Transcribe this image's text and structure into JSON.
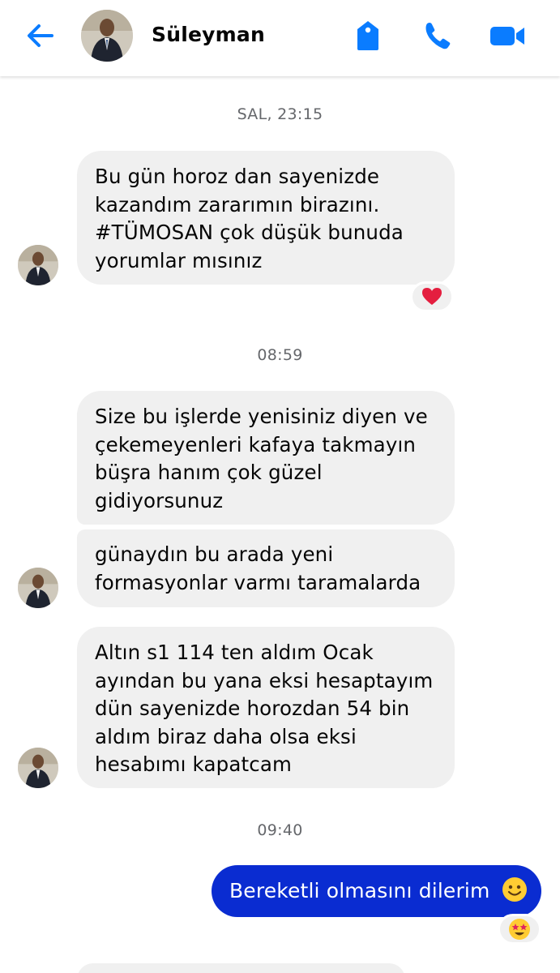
{
  "header": {
    "contact_name": "Süleyman",
    "icons": [
      "back-arrow-icon",
      "tag-icon",
      "phone-icon",
      "video-camera-icon"
    ],
    "accent_color": "#0a7cff"
  },
  "messages": {
    "ts1": "SAL, 23:15",
    "m1": {
      "lines": [
        "Bu gün horoz dan sayenizde",
        "kazandım zararımın birazını.",
        "#TÜMOSAN çok düşük bunuda",
        "yorumlar mısınız"
      ],
      "reaction": "heart"
    },
    "ts2": "08:59",
    "m2": {
      "lines": [
        "Size bu işlerde yenisiniz diyen ve",
        "çekemeyenleri kafaya takmayın",
        "büşra hanım çok güzel",
        "gidiyorsunuz"
      ]
    },
    "m3": {
      "lines": [
        "günaydın bu arada yeni",
        "formasyonlar varmı taramalarda"
      ]
    },
    "m4": {
      "lines": [
        "Altın s1 114 ten aldım Ocak",
        "ayından bu yana eksi hesaptayım",
        "dün sayenizde horozdan 54 bin",
        "aldım biraz daha olsa eksi",
        "hesabımı kapatcam"
      ]
    },
    "ts3": "09:40",
    "out1": {
      "text": "Bereketli olmasını dilerim",
      "emoji": "slightly-smiling-face",
      "reaction": "star-struck"
    }
  },
  "colors": {
    "incoming_bubble": "#f0f0f0",
    "outgoing_bubble": "#0a2cd1",
    "timestamp_text": "#65676b",
    "heart": "#e41e3f"
  }
}
